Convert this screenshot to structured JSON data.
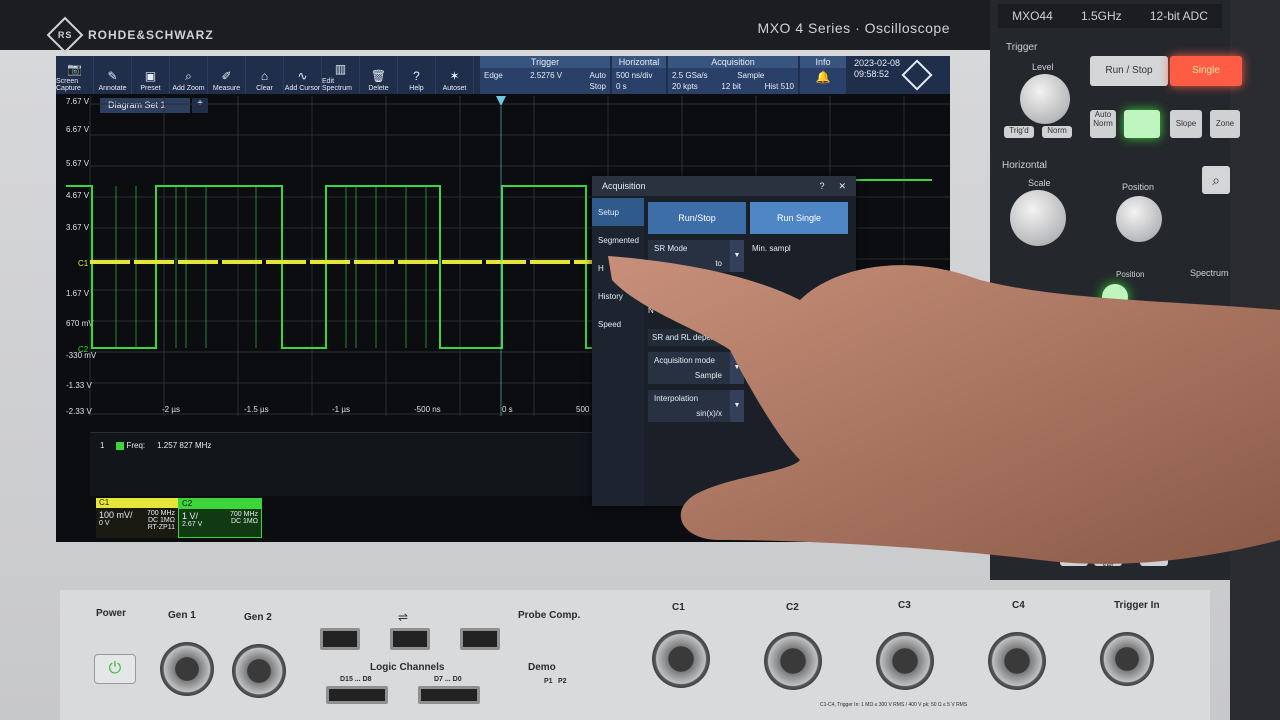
{
  "device": {
    "brand": "ROHDE&SCHWARZ",
    "brand_logo_letters": "RS",
    "series_label": "MXO 4 Series · Oscilloscope",
    "model_badge": {
      "model": "MXO44",
      "bandwidth": "1.5GHz",
      "adc": "12-bit ADC"
    }
  },
  "toolbar": {
    "buttons": [
      {
        "name": "screen-capture",
        "label": "Screen Capture",
        "icon": "camera-icon",
        "glyph": "📷"
      },
      {
        "name": "annotate",
        "label": "Annotate",
        "icon": "pencil-icon",
        "glyph": "✎"
      },
      {
        "name": "preset",
        "label": "Preset",
        "icon": "preset-icon",
        "glyph": "▣"
      },
      {
        "name": "add-zoom",
        "label": "Add Zoom",
        "icon": "zoom-icon",
        "glyph": "⌕"
      },
      {
        "name": "measure",
        "label": "Measure",
        "icon": "measure-icon",
        "glyph": "✐"
      },
      {
        "name": "clear",
        "label": "Clear",
        "icon": "clear-icon",
        "glyph": "⌂"
      },
      {
        "name": "add-cursor",
        "label": "Add Cursor",
        "icon": "cursor-icon",
        "glyph": "∿"
      },
      {
        "name": "edit-spectrum",
        "label": "Edit Spectrum",
        "icon": "spectrum-icon",
        "glyph": "▥"
      },
      {
        "name": "delete",
        "label": "Delete",
        "icon": "trash-icon",
        "glyph": "🗑"
      },
      {
        "name": "help",
        "label": "Help",
        "icon": "help-icon",
        "glyph": "?"
      },
      {
        "name": "autoset",
        "label": "Autoset",
        "icon": "autoset-icon",
        "glyph": "✶"
      }
    ],
    "trigger": {
      "title": "Trigger",
      "type": "Edge",
      "level": "2.5276 V",
      "mode": "Auto",
      "state": "Stop"
    },
    "horizontal": {
      "title": "Horizontal",
      "scale": "500 ns/div",
      "position": "0 s"
    },
    "acquisition": {
      "title": "Acquisition",
      "rate": "2.5 GSa/s",
      "points": "20 kpts",
      "mode": "Sample",
      "bits": "12 bit",
      "hist": "Hist 510"
    },
    "info": {
      "title": "Info"
    },
    "datetime": {
      "date": "2023-02-08",
      "time": "09:58:52"
    }
  },
  "diagram": {
    "tab_label": "Diagram Set 1",
    "add_label": "+"
  },
  "waveform": {
    "volt_labels": [
      "7.67 V",
      "6.67 V",
      "5.67 V",
      "4.67 V",
      "3.67 V",
      "1.67 V",
      "670 mV",
      "-330 mV",
      "-1.33 V",
      "-2.33 V"
    ],
    "time_labels": [
      "-2 µs",
      "-1.5 µs",
      "-1 µs",
      "-500 ns",
      "0 s",
      "500"
    ],
    "c1_marker": "C1",
    "c2_marker": "C2",
    "c1_color": "#e6e63a",
    "c2_color": "#3cd63c"
  },
  "measurement": {
    "index": "1",
    "label": "Freq:",
    "value": "1.257 827 MHz"
  },
  "channels": [
    {
      "name": "C1",
      "scale": "100 mV/",
      "offset": "0 V",
      "bw": "700 MHz",
      "coupling": "DC 1MΩ",
      "probe": "RT-ZP11",
      "color": "#e6e63a"
    },
    {
      "name": "C2",
      "scale": "1 V/",
      "offset": "2.67 V",
      "bw": "700 MHz",
      "coupling": "DC 1MΩ",
      "probe": "",
      "color": "#3cd63c"
    }
  ],
  "dialog": {
    "title": "Acquisition",
    "tabs": [
      "Setup",
      "Segmented",
      "H",
      "History",
      "Speed"
    ],
    "run_stop": "Run/Stop",
    "run_single": "Run Single",
    "sr_mode_label": "SR Mode",
    "sr_mode_value": "to",
    "min_sample_label": "Min. sampl",
    "n_label": "N",
    "sr_rl_section": "SR and RL depen",
    "acq_mode_label": "Acquisition mode",
    "acq_mode_value": "Sample",
    "interp_label": "Interpolation",
    "interp_value": "sin(x)/x"
  },
  "panel": {
    "trigger_title": "Trigger",
    "level_label": "Level",
    "run_stop": "Run / Stop",
    "single": "Single",
    "trig_d": "Trig'd",
    "norm": "Norm",
    "auto_norm": "Auto Norm",
    "slope": "Slope",
    "zone": "Zone",
    "horizontal_title": "Horizontal",
    "scale_label": "Scale",
    "position_label": "Position",
    "position_label2": "Position",
    "spectrum_label": "Spectrum",
    "preset": "Preset",
    "autoset": "Auto set",
    "clear": "Clear"
  },
  "front": {
    "power": "Power",
    "gen1": "Gen 1",
    "gen2": "Gen 2",
    "logic_channels": "Logic Channels",
    "d15": "D15 ... D8",
    "d7": "D7 ... D0",
    "probe_comp": "Probe Comp.",
    "demo": "Demo",
    "p1": "P1",
    "p2": "P2",
    "c1": "C1",
    "c2": "C2",
    "c3": "C3",
    "c4": "C4",
    "trigger_in": "Trigger In",
    "fine_print": "C1-C4, Trigger In: 1 MΩ ≤ 300 V RMS / 400 V pk; 50 Ω ≤ 5 V RMS"
  }
}
